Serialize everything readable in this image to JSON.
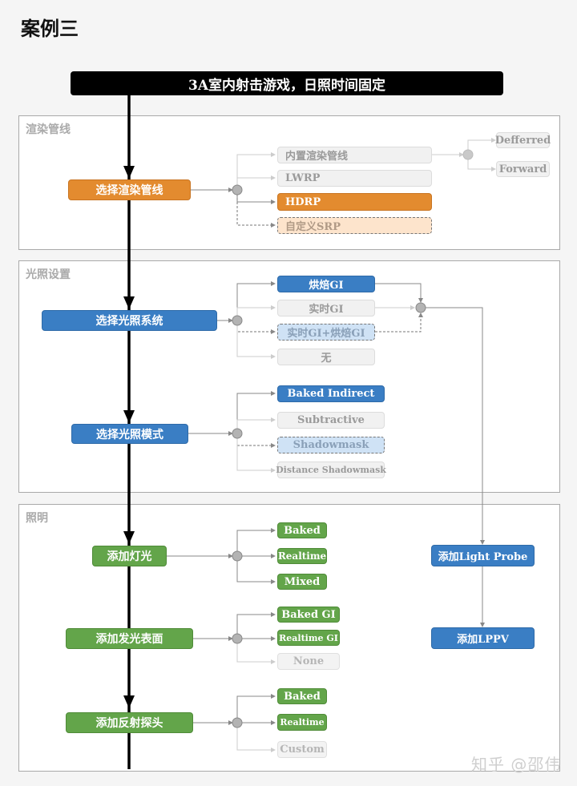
{
  "title": "案例三",
  "banner": "3A室内射击游戏，日照时间固定",
  "sections": {
    "pipeline": {
      "label": "渲染管线"
    },
    "lighting_settings": {
      "label": "光照设置"
    },
    "illumination": {
      "label": "照明"
    }
  },
  "nodes": {
    "select_pipeline": "选择渲染管线",
    "builtin_pipeline": "内置渲染管线",
    "lwrp": "LWRP",
    "hdrp": "HDRP",
    "custom_srp": "自定义SRP",
    "deferred": "Defferred",
    "forward": "Forward",
    "select_lighting_system": "选择光照系统",
    "baked_gi": "烘焙GI",
    "realtime_gi": "实时GI",
    "realtime_baked_gi": "实时GI+烘焙GI",
    "none_cn": "无",
    "select_lighting_mode": "选择光照模式",
    "baked_indirect": "Baked Indirect",
    "subtractive": "Subtractive",
    "shadowmask": "Shadowmask",
    "distance_shadowmask": "Distance Shadowmask",
    "add_light": "添加灯光",
    "light_baked": "Baked",
    "light_realtime": "Realtime",
    "light_mixed": "Mixed",
    "add_emissive": "添加发光表面",
    "emissive_baked_gi": "Baked GI",
    "emissive_realtime_gi": "Realtime GI",
    "emissive_none": "None",
    "add_reflection_probe": "添加反射探头",
    "probe_baked": "Baked",
    "probe_realtime": "Realtime",
    "probe_custom": "Custom",
    "add_light_probe": "添加Light Probe",
    "add_lppv": "添加LPPV"
  },
  "watermark": "知乎 @邵伟",
  "colors": {
    "orange": "#e38b2f",
    "blue": "#3a7ec4",
    "green": "#63a54a",
    "grey": "#f1f1f1",
    "peach": "#fde4cc",
    "light_blue": "#cfe2f5"
  }
}
